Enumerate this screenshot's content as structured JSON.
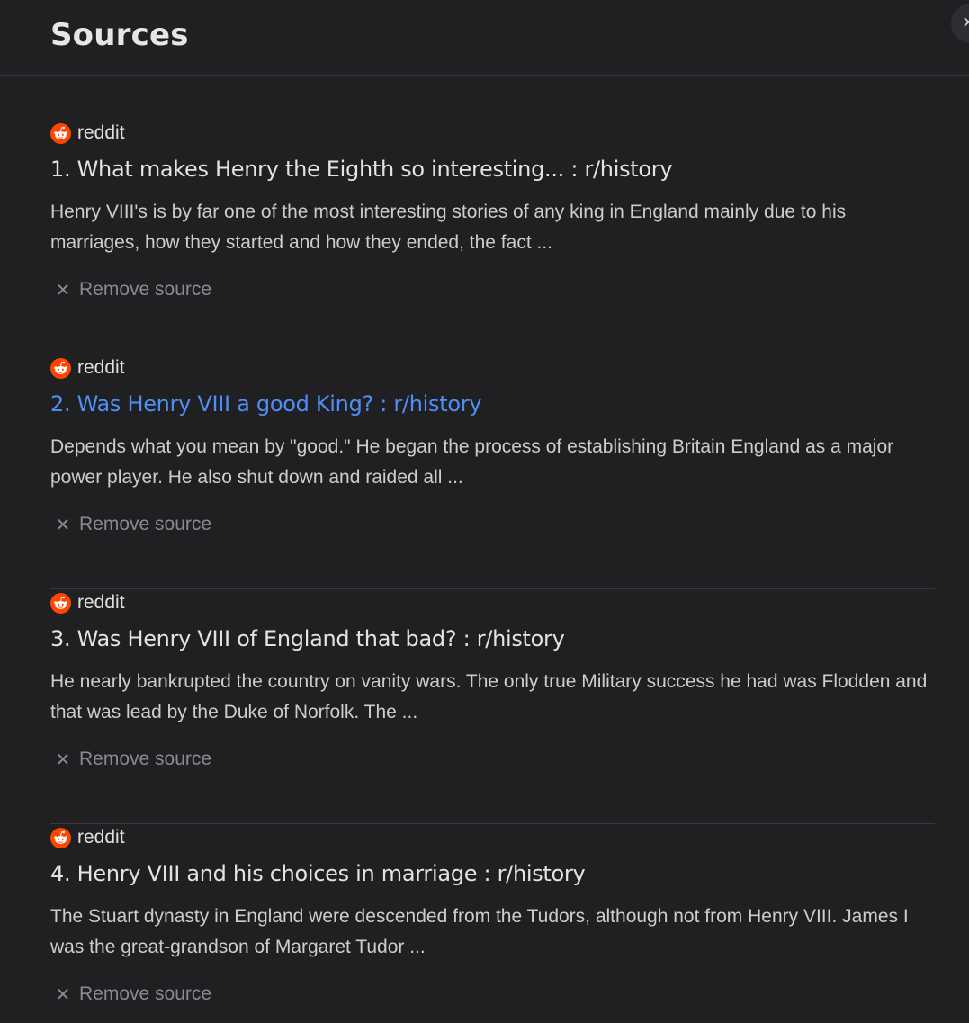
{
  "header": {
    "title": "Sources",
    "close_glyph": "✕"
  },
  "colors": {
    "background": "#202023",
    "link_hover": "#4e8ff4",
    "reddit_orange": "#ff4500"
  },
  "sources": [
    {
      "site": "reddit",
      "icon": "reddit-icon",
      "title": "1. What makes Henry the Eighth so interesting... : r/history",
      "snippet": "Henry VIII's is by far one of the most interesting stories of any king in England mainly due to his marriages, how they started and how they ended, the fact ...",
      "remove_glyph": "✕",
      "remove_label": "Remove source"
    },
    {
      "site": "reddit",
      "icon": "reddit-icon",
      "title": "2. Was Henry VIII a good King? : r/history",
      "snippet": "Depends what you mean by \"good.\" He began the process of establishing Britain England as a major power player. He also shut down and raided all ...",
      "remove_glyph": "✕",
      "remove_label": "Remove source",
      "hovered": true
    },
    {
      "site": "reddit",
      "icon": "reddit-icon",
      "title": "3. Was Henry VIII of England that bad? : r/history",
      "snippet": "He nearly bankrupted the country on vanity wars. The only true Military success he had was Flodden and that was lead by the Duke of Norfolk. The ...",
      "remove_glyph": "✕",
      "remove_label": "Remove source"
    },
    {
      "site": "reddit",
      "icon": "reddit-icon",
      "title": "4. Henry VIII and his choices in marriage : r/history",
      "snippet": "The Stuart dynasty in England were descended from the Tudors, although not from Henry VIII. James I was the great-grandson of Margaret Tudor ...",
      "remove_glyph": "✕",
      "remove_label": "Remove source"
    }
  ]
}
